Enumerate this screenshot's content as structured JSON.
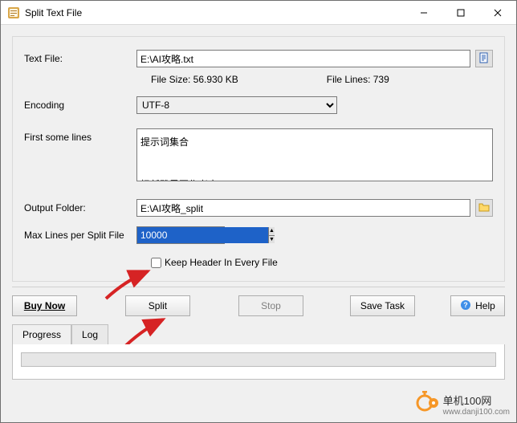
{
  "window": {
    "title": "Split Text File"
  },
  "labels": {
    "text_file": "Text File:",
    "encoding": "Encoding",
    "first_lines": "First some lines",
    "output_folder": "Output Folder:",
    "max_lines": "Max Lines per Split File",
    "keep_header": "Keep Header In Every File"
  },
  "fields": {
    "text_file": "E:\\AI攻略.txt",
    "file_size_label": "File Size: 56.930 KB",
    "file_lines_label": "File Lines: 739",
    "encoding": "UTF-8",
    "preview": "提示词集合\n\n担任雅思写作考官",
    "output_folder": "E:\\AI攻略_split",
    "max_lines": "10000"
  },
  "buttons": {
    "buy": "Buy Now",
    "split": "Split",
    "stop": "Stop",
    "save": "Save Task",
    "help": "Help"
  },
  "tabs": {
    "progress": "Progress",
    "log": "Log"
  },
  "watermark": {
    "line1": "单机100网",
    "line2": "www.danji100.com"
  }
}
